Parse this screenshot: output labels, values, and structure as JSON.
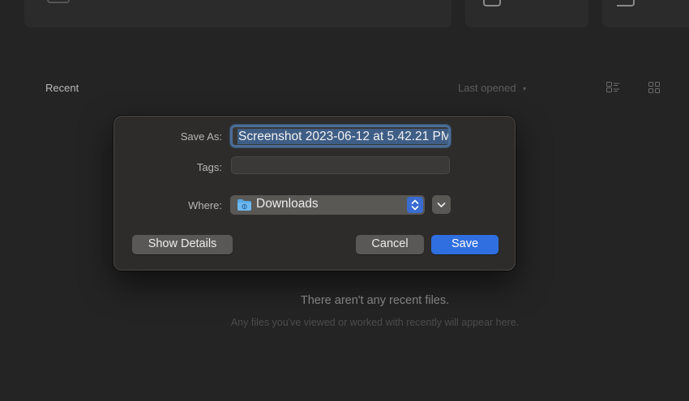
{
  "background": {
    "recent_label": "Recent",
    "sort_label": "Last opened",
    "sort_caret": "▾",
    "empty_title": "There aren't any recent files.",
    "empty_subtitle": "Any files you've viewed or worked with recently will appear here."
  },
  "dialog": {
    "save_as_label": "Save As:",
    "save_as_value": "Screenshot 2023-06-12 at 5.42.21 PM",
    "tags_label": "Tags:",
    "tags_value": "",
    "where_label": "Where:",
    "where_value": "Downloads",
    "show_details_label": "Show Details",
    "cancel_label": "Cancel",
    "save_label": "Save"
  },
  "colors": {
    "accent": "#2f6fe0",
    "background": "#242424",
    "dialog": "#2e2c2a"
  },
  "icons": [
    "folder-icon",
    "stepper-icon",
    "chevron-down-icon",
    "list-view-icon",
    "grid-view-icon"
  ]
}
